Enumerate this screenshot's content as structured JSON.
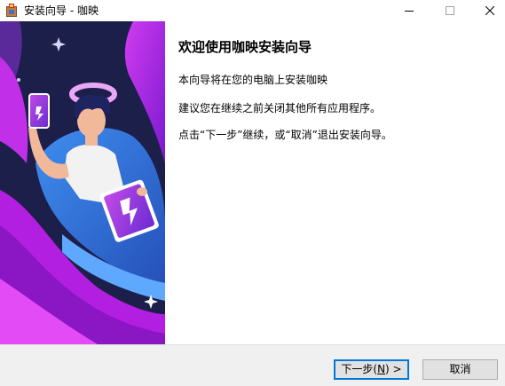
{
  "window": {
    "title": "安装向导 - 咖映",
    "icon": "installer-icon",
    "controls": {
      "minimize": "minimize-icon",
      "maximize": "maximize-icon",
      "close": "close-icon"
    }
  },
  "content": {
    "heading": "欢迎使用咖映安装向导",
    "paragraph_1": "本向导将在您的电脑上安装咖映",
    "paragraph_2": "建议您在继续之前关闭其他所有应用程序。",
    "paragraph_3": "点击“下一步”继续，或“取消”退出安装向导。"
  },
  "buttons": {
    "next_prefix": "下一步(",
    "next_accel": "N",
    "next_suffix": ") >",
    "cancel": "取消"
  },
  "colors": {
    "banner_bg": "#1d1f4b",
    "banner_purple": "#b21fe0",
    "banner_blue": "#2f6fd8",
    "accent": "#0078d7"
  }
}
